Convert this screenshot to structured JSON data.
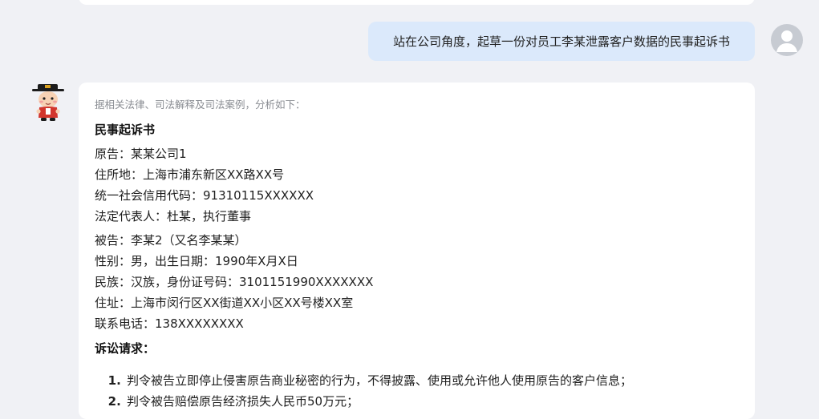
{
  "user_message": "站在公司角度，起草一份对员工李某泄露客户数据的民事起诉书",
  "answer": {
    "intro": "据相关法律、司法解释及司法案例，分析如下：",
    "doc_title": "民事起诉书",
    "plaintiff": [
      "原告：某某公司1",
      "住所地：上海市浦东新区XX路XX号",
      "统一社会信用代码：91310115XXXXXX",
      "法定代表人：杜某，执行董事"
    ],
    "defendant": [
      "被告：李某2（又名李某某）",
      "性别：男，出生日期：1990年X月X日",
      "民族：汉族，身份证号码：3101151990XXXXXXX",
      "住址：上海市闵行区XX街道XX小区XX号楼XX室",
      "联系电话：138XXXXXXXX"
    ],
    "claims_title": "诉讼请求：",
    "claims": [
      "判令被告立即停止侵害原告商业秘密的行为，不得披露、使用或允许他人使用原告的客户信息；",
      "判令被告赔偿原告经济损失人民币50万元；"
    ]
  }
}
